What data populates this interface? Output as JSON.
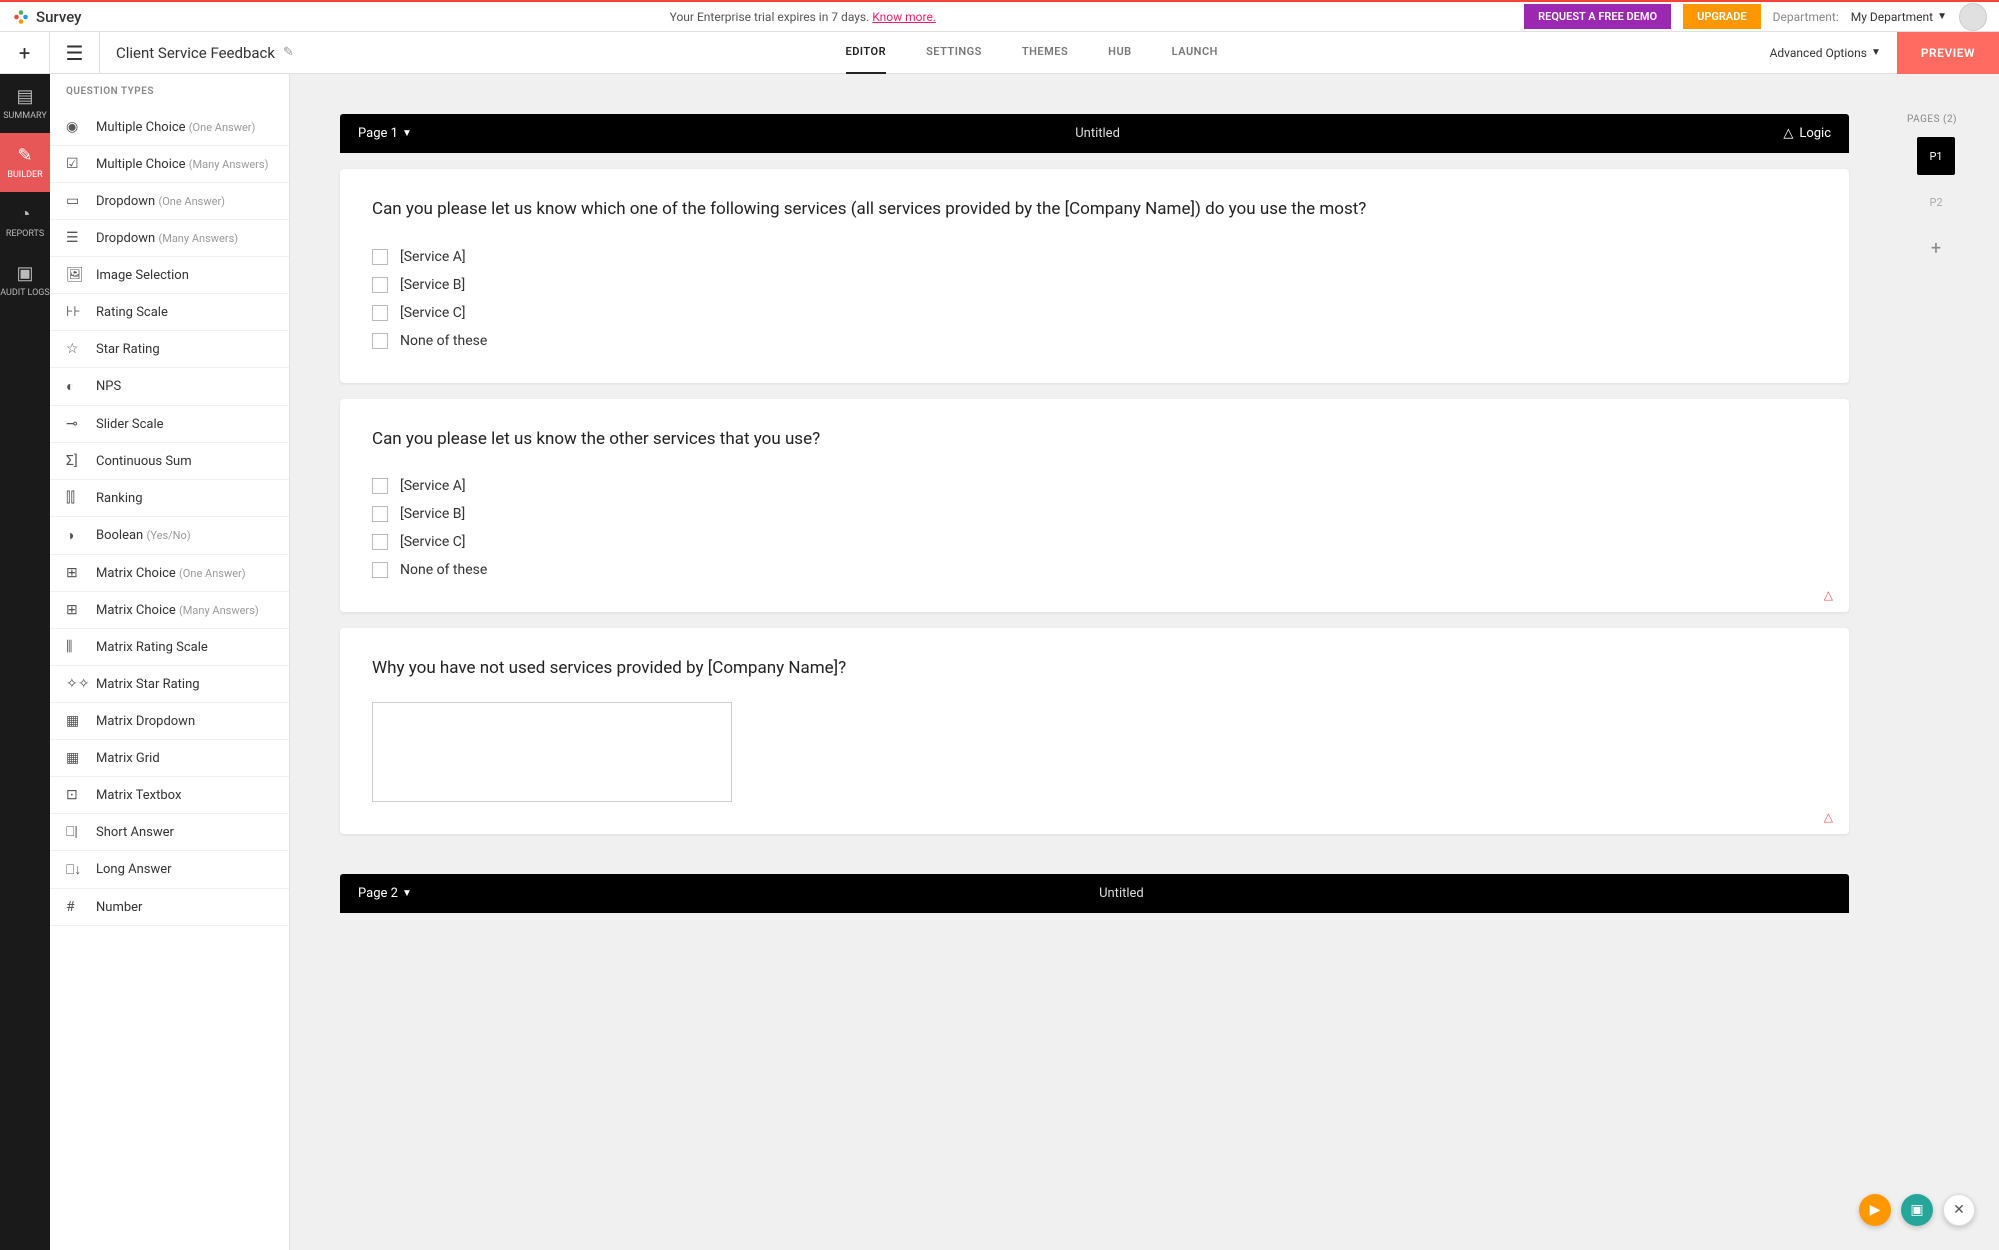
{
  "topbar": {
    "brand": "Survey",
    "trial_text": "Your Enterprise trial expires in 7 days. ",
    "trial_link": "Know more.",
    "demo_btn": "REQUEST A FREE DEMO",
    "upgrade_btn": "UPGRADE",
    "dept_label": "Department:",
    "dept_value": "My Department"
  },
  "secondbar": {
    "title": "Client Service Feedback",
    "tabs": [
      "EDITOR",
      "SETTINGS",
      "THEMES",
      "HUB",
      "LAUNCH"
    ],
    "adv": "Advanced Options",
    "preview": "PREVIEW"
  },
  "leftnav": {
    "items": [
      {
        "label": "SUMMARY"
      },
      {
        "label": "BUILDER"
      },
      {
        "label": "REPORTS"
      },
      {
        "label": "AUDIT LOGS"
      }
    ]
  },
  "qtypes": {
    "header": "QUESTION TYPES",
    "items": [
      {
        "icon": "◉",
        "label": "Multiple Choice",
        "sub": "(One Answer)"
      },
      {
        "icon": "☑",
        "label": "Multiple Choice",
        "sub": "(Many Answers)"
      },
      {
        "icon": "▭",
        "label": "Dropdown",
        "sub": "(One Answer)"
      },
      {
        "icon": "☰",
        "label": "Dropdown",
        "sub": "(Many Answers)"
      },
      {
        "icon": "🖼",
        "label": "Image Selection",
        "sub": ""
      },
      {
        "icon": "⊦⊦",
        "label": "Rating Scale",
        "sub": ""
      },
      {
        "icon": "☆",
        "label": "Star Rating",
        "sub": ""
      },
      {
        "icon": "◐",
        "label": "NPS",
        "sub": ""
      },
      {
        "icon": "⊸",
        "label": "Slider Scale",
        "sub": ""
      },
      {
        "icon": "Σ]",
        "label": "Continuous Sum",
        "sub": ""
      },
      {
        "icon": "⫿⫿",
        "label": "Ranking",
        "sub": ""
      },
      {
        "icon": "◑",
        "label": "Boolean",
        "sub": "(Yes/No)"
      },
      {
        "icon": "⊞",
        "label": "Matrix Choice",
        "sub": "(One Answer)"
      },
      {
        "icon": "⊞",
        "label": "Matrix Choice",
        "sub": "(Many Answers)"
      },
      {
        "icon": "⫼",
        "label": "Matrix Rating Scale",
        "sub": ""
      },
      {
        "icon": "✧✧",
        "label": "Matrix Star Rating",
        "sub": ""
      },
      {
        "icon": "▦",
        "label": "Matrix Dropdown",
        "sub": ""
      },
      {
        "icon": "▦",
        "label": "Matrix Grid",
        "sub": ""
      },
      {
        "icon": "⊡",
        "label": "Matrix Textbox",
        "sub": ""
      },
      {
        "icon": "⎕|",
        "label": "Short Answer",
        "sub": ""
      },
      {
        "icon": "⎕↓",
        "label": "Long Answer",
        "sub": ""
      },
      {
        "icon": "#",
        "label": "Number",
        "sub": ""
      }
    ]
  },
  "canvas": {
    "page1": {
      "label": "Page 1",
      "name": "Untitled",
      "logic": "Logic"
    },
    "page2": {
      "label": "Page 2",
      "name": "Untitled"
    },
    "questions": [
      {
        "text": "Can you please let us know which one of the following services (all services provided by the [Company Name]) do you use the most?",
        "options": [
          "[Service A]",
          "[Service B]",
          "[Service C]",
          "None of these"
        ],
        "has_logic": false
      },
      {
        "text": "Can you please let us know the other services that you use?",
        "options": [
          "[Service A]",
          "[Service B]",
          "[Service C]",
          "None of these"
        ],
        "has_logic": true
      },
      {
        "text": "Why you have not used services provided by [Company Name]?",
        "type": "textarea",
        "has_logic": true
      }
    ]
  },
  "right": {
    "pages_label": "PAGES (2)",
    "thumbs": [
      "P1",
      "P2"
    ]
  }
}
